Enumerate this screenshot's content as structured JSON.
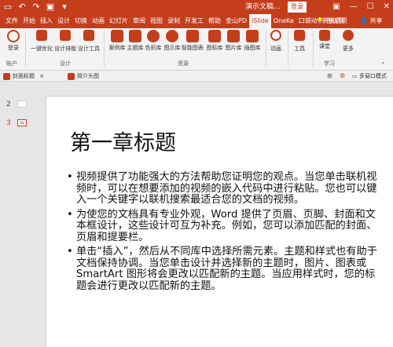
{
  "titlebar": {
    "title": "演示文稿...",
    "login": "登录"
  },
  "tabs": [
    {
      "label": "文件"
    },
    {
      "label": "开始"
    },
    {
      "label": "插入"
    },
    {
      "label": "设计"
    },
    {
      "label": "切换"
    },
    {
      "label": "动画"
    },
    {
      "label": "幻灯片"
    },
    {
      "label": "审阅"
    },
    {
      "label": "视图"
    },
    {
      "label": "录制"
    },
    {
      "label": "开发工"
    },
    {
      "label": "帮助"
    },
    {
      "label": "金山PD"
    },
    {
      "label": "iSlide",
      "active": true
    },
    {
      "label": "OneKe"
    },
    {
      "label": "口袋动"
    },
    {
      "label": "新建选项"
    }
  ],
  "tell_me": "告诉我",
  "share": "共享",
  "ribbon": {
    "account": {
      "login": "登录",
      "group": "账户"
    },
    "design": {
      "one_click": "一键优化",
      "layout": "设计排版",
      "tools": "设计工具",
      "group": "设计"
    },
    "resources": {
      "case": "案例库",
      "theme": "主题库",
      "color": "色彩库",
      "icon": "图示库",
      "smart": "智能图表",
      "icons": "图标库",
      "pictures": "图片库",
      "illustrations": "插图库",
      "group": "资源"
    },
    "animation": {
      "label": "动画"
    },
    "tools": {
      "label": "工具"
    },
    "learn": {
      "course": "课堂",
      "more": "更多",
      "group": "学习"
    }
  },
  "doc_tabs": [
    {
      "label": "封面标题"
    },
    {
      "label": "简介头图"
    }
  ],
  "multi_window": "多窗口模式",
  "thumbnails": [
    {
      "num": "2"
    },
    {
      "num": "3"
    }
  ],
  "slide": {
    "title": "第一章标题",
    "bullets": [
      "视频提供了功能强大的方法帮助您证明您的观点。当您单击联机视频时，可以在想要添加的视频的嵌入代码中进行粘贴。您也可以键入一个关键字以联机搜索最适合您的文档的视频。",
      "为使您的文档具有专业外观，Word 提供了页眉、页脚、封面和文本框设计，这些设计可互为补充。例如，您可以添加匹配的封面、页眉和提要栏。",
      "单击“插入”，然后从不同库中选择所需元素。主题和样式也有助于文档保持协调。当您单击设计并选择新的主题时，图片、图表或 SmartArt 图形将会更改以匹配新的主题。当应用样式时，您的标题会进行更改以匹配新的主题。"
    ]
  },
  "colors": {
    "accent": "#c43e1c",
    "ribbon_bg": "#f3f3f3",
    "workspace": "#e6e6e6"
  }
}
